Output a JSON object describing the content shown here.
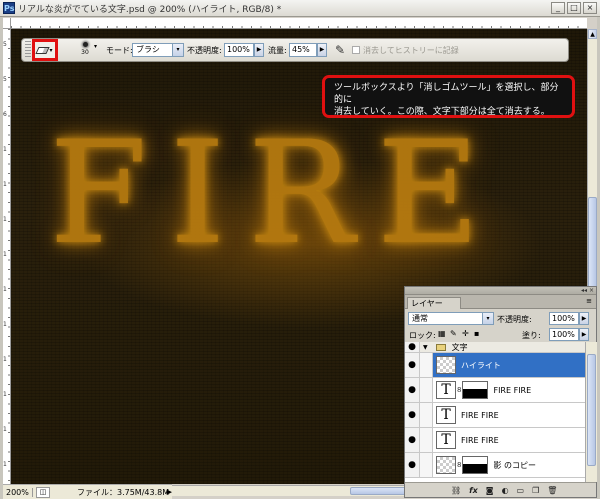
{
  "window": {
    "app_badge": "Ps",
    "title": "リアルな炎がでている文字.psd @ 200% (ハイライト, RGB/8) *",
    "minimize": "_",
    "maximize": "□",
    "close": "×"
  },
  "rulers": {
    "left_labels": [
      "5",
      "5",
      "6",
      "1",
      "1",
      "1",
      "1",
      "1",
      "1",
      "1",
      "1",
      "1",
      "1"
    ]
  },
  "options_bar": {
    "tool_arrow": "▾",
    "brush_size": "30",
    "brush_arrow": "▾",
    "mode_label": "モード:",
    "mode_value": "ブラシ",
    "opacity_label": "不透明度:",
    "opacity_value": "100%",
    "flow_label": "流量:",
    "flow_value": "45%",
    "history_label": "消去してヒストリーに記録"
  },
  "callout": {
    "line1": "ツールボックスより「消しゴムツール」を選択し、部分的に",
    "line2": "消去していく。この際、文字下部分は全て消去する。"
  },
  "canvas": {
    "text": "FIRE"
  },
  "status_bar": {
    "zoom": "200%",
    "file_info": "ファイル：3.75M/43.8M",
    "arrow": "▶"
  },
  "layers_panel": {
    "tab_label": "レイヤー",
    "menu_icon": "≡",
    "blend_mode": "通常",
    "opacity_label": "不透明度:",
    "opacity_value": "100%",
    "lock_label": "ロック:",
    "fill_label": "塗り:",
    "fill_value": "100%",
    "layers": [
      {
        "name": "文字",
        "type": "group"
      },
      {
        "name": "ハイライト",
        "type": "pixel",
        "selected": true
      },
      {
        "name": "FIRE FIRE",
        "type": "text-mask"
      },
      {
        "name": "FIRE FIRE",
        "type": "text"
      },
      {
        "name": "FIRE FIRE",
        "type": "text"
      },
      {
        "name": "影 のコピー",
        "type": "pixel-mask"
      }
    ],
    "bottom_icons": [
      "link-icon",
      "fx-icon",
      "mask-icon",
      "adjustment-icon",
      "folder-icon",
      "new-layer-icon",
      "trash-icon"
    ]
  },
  "colors": {
    "highlight_red": "#e01010",
    "fire_orange": "#b67a10",
    "selected_blue": "#3170c5",
    "canvas_dark": "#221a08"
  }
}
